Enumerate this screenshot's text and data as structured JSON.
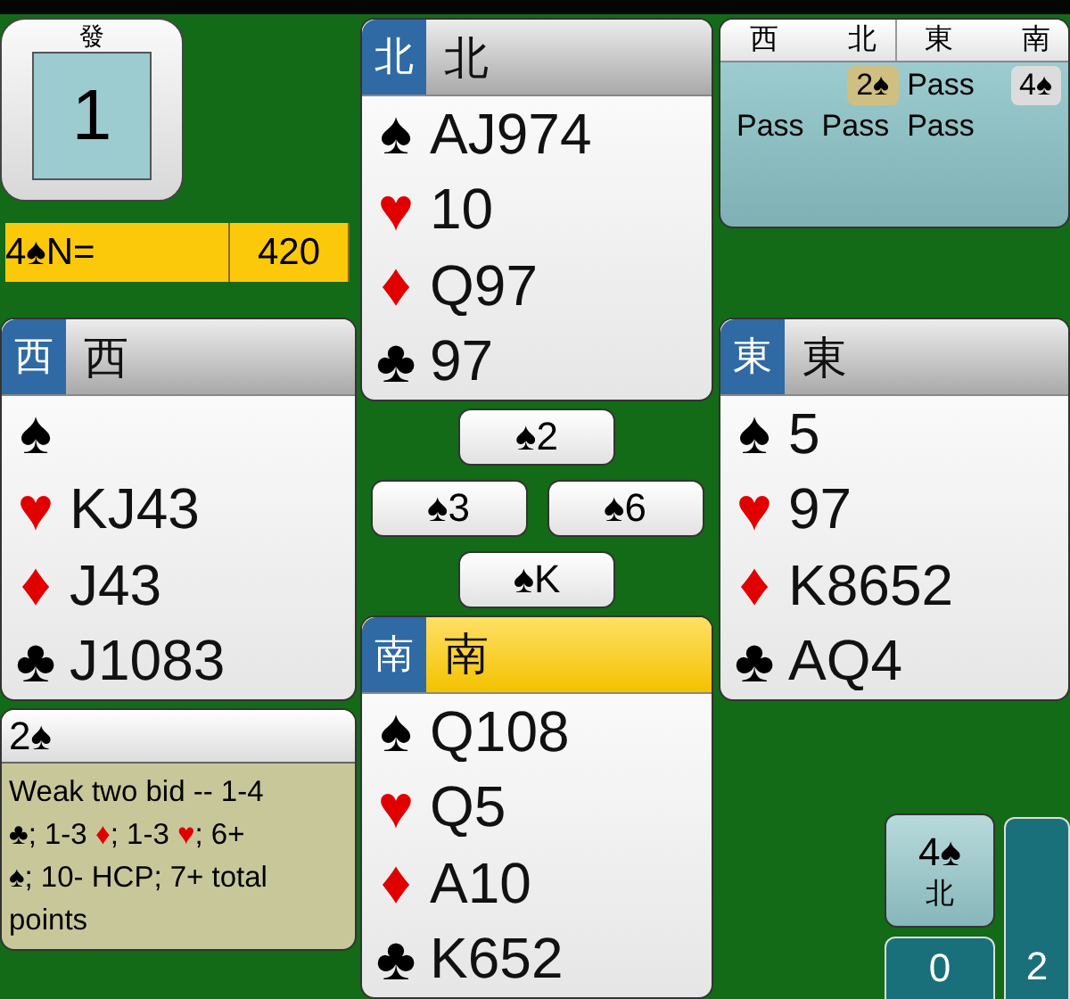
{
  "vulnerability": {
    "label": "發",
    "board": "1"
  },
  "contract_bar": {
    "contract": "4♠N=",
    "score": "420"
  },
  "auction": {
    "headers": [
      "西",
      "北",
      "東",
      "南"
    ],
    "bids": [
      {
        "kind": "empty"
      },
      {
        "text": "2♠",
        "kind": "explained"
      },
      {
        "text": "Pass",
        "kind": "plain"
      },
      {
        "text": "4♠",
        "kind": "final"
      },
      {
        "text": "Pass",
        "kind": "plain"
      },
      {
        "text": "Pass",
        "kind": "plain"
      },
      {
        "text": "Pass",
        "kind": "plain"
      }
    ]
  },
  "hands": [
    {
      "kind": "north",
      "seat": "北",
      "name": "北",
      "active": false,
      "suits": [
        {
          "symbol": "♠",
          "color": "#000000",
          "cards": "AJ974"
        },
        {
          "symbol": "♥",
          "color": "#e00000",
          "cards": "10"
        },
        {
          "symbol": "♦",
          "color": "#e00000",
          "cards": "Q97"
        },
        {
          "symbol": "♣",
          "color": "#000000",
          "cards": "97"
        }
      ]
    },
    {
      "kind": "west",
      "seat": "西",
      "name": "西",
      "active": false,
      "suits": [
        {
          "symbol": "♠",
          "color": "#000000"
        },
        {
          "symbol": "♥",
          "color": "#e00000",
          "cards": "KJ43"
        },
        {
          "symbol": "♦",
          "color": "#e00000",
          "cards": "J43"
        },
        {
          "symbol": "♣",
          "color": "#000000",
          "cards": "J1083"
        }
      ]
    },
    {
      "kind": "east",
      "seat": "東",
      "name": "東",
      "active": false,
      "suits": [
        {
          "symbol": "♠",
          "color": "#000000",
          "cards": "5"
        },
        {
          "symbol": "♥",
          "color": "#e00000",
          "cards": "97"
        },
        {
          "symbol": "♦",
          "color": "#e00000",
          "cards": "K8652"
        },
        {
          "symbol": "♣",
          "color": "#000000",
          "cards": "AQ4"
        }
      ]
    },
    {
      "kind": "south",
      "seat": "南",
      "name": "南",
      "active": true,
      "suits": [
        {
          "symbol": "♠",
          "color": "#000000",
          "cards": "Q108"
        },
        {
          "symbol": "♥",
          "color": "#e00000",
          "cards": "Q5"
        },
        {
          "symbol": "♦",
          "color": "#e00000",
          "cards": "A10"
        },
        {
          "symbol": "♣",
          "color": "#000000",
          "cards": "K652"
        }
      ]
    }
  ],
  "trick": [
    {
      "kind": "north",
      "card": "♠2"
    },
    {
      "kind": "west",
      "card": "♠3"
    },
    {
      "kind": "east",
      "card": "♠6"
    },
    {
      "kind": "south",
      "card": "♠K"
    }
  ],
  "explanation": {
    "bid": "2♠",
    "lines": [
      [
        {
          "text": "Weak two bid -- 1-4",
          "color": "#000000"
        }
      ],
      [
        {
          "text": "♣; 1-3 ",
          "color": "#000000"
        },
        {
          "text": "♦",
          "color": "#e00000"
        },
        {
          "text": "; 1-3 ",
          "color": "#000000"
        },
        {
          "text": "♥",
          "color": "#e00000"
        },
        {
          "text": "; 6+",
          "color": "#000000"
        }
      ],
      [
        {
          "text": "♠; 10- HCP; 7+ total",
          "color": "#000000"
        }
      ],
      [
        {
          "text": "points",
          "color": "#000000"
        }
      ]
    ]
  },
  "final_contract": {
    "contract": "4♠",
    "declarer": "北"
  },
  "tricks_score": {
    "ns": "0",
    "ew": "2"
  }
}
